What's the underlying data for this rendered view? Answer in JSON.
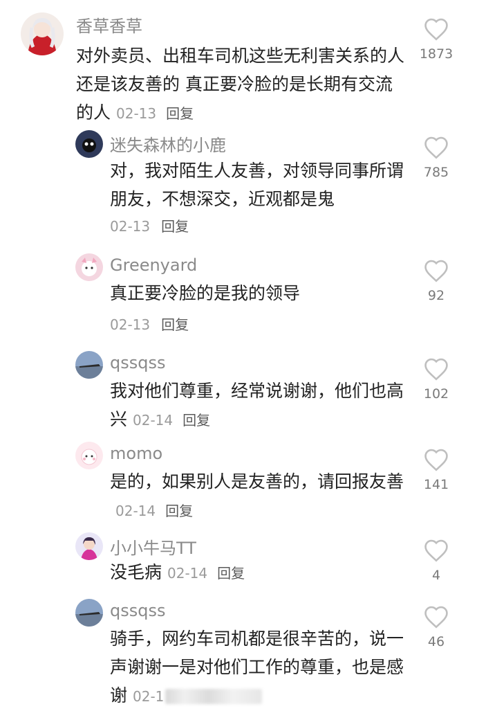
{
  "comments": [
    {
      "user": "香草香草",
      "text": "对外卖员、出租车司机这些无利害关系的人还是该友善的 真正要冷脸的是长期有交流的人",
      "date": "02-13",
      "reply": "回复",
      "likes": "1873"
    },
    {
      "user": "迷失森林的小鹿",
      "text": "对，我对陌生人友善，对领导同事所谓朋友，不想深交，近观都是鬼",
      "date": "02-13",
      "reply": "回复",
      "likes": "785"
    },
    {
      "user": "Greenyard",
      "text": "真正要冷脸的是我的领导",
      "date": "02-13",
      "reply": "回复",
      "likes": "92"
    },
    {
      "user": "qssqss",
      "text": "我对他们尊重，经常说谢谢，他们也高兴",
      "date": "02-14",
      "reply": "回复",
      "likes": "102"
    },
    {
      "user": "momo",
      "text": "是的，如果别人是友善的，请回报友善",
      "date": "02-14",
      "reply": "回复",
      "likes": "141"
    },
    {
      "user": "小小牛马TT",
      "text": "没毛病",
      "date": "02-14",
      "reply": "回复",
      "likes": "4"
    },
    {
      "user": "qssqss",
      "text": "骑手，网约车司机都是很辛苦的，说一声谢谢一是对他们工作的尊重，也是感谢",
      "date": "02-1",
      "likes": "46"
    }
  ],
  "colors": {
    "text": "#222222",
    "meta": "#9a9a9a",
    "name": "#8a8a8a"
  }
}
